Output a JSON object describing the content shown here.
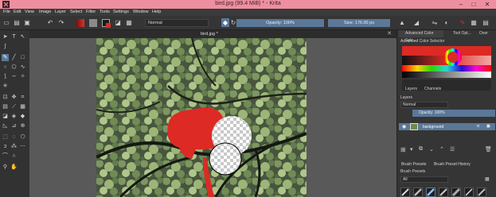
{
  "window": {
    "title": "bird.jpg (99.4 MiB) * - Krita",
    "minimize": "–",
    "maximize": "□",
    "close": "✕"
  },
  "menu": [
    "File",
    "Edit",
    "View",
    "Image",
    "Layer",
    "Select",
    "Filter",
    "Tools",
    "Settings",
    "Window",
    "Help"
  ],
  "toolbar": {
    "blend_mode": "Normal",
    "opacity_label": "Opacity: 100%",
    "size_label": "Size: 176.00 px"
  },
  "document": {
    "tab_name": "bird.jpg *",
    "close": "✕"
  },
  "dock": {
    "tabs": [
      "Advanced Color Sele...",
      "Tool Opt...",
      "Over"
    ],
    "color_selector_title": "Advanced Color Selector",
    "layer_tabs": [
      "Layers",
      "Channels"
    ],
    "layers_title": "Layers",
    "blend_mode": "Normal",
    "opacity_label": "Opacity: 100%",
    "layer_name": "background",
    "brush_tabs": [
      "Brush Presets",
      "Brush Preset History"
    ],
    "brush_presets_title": "Brush Presets",
    "brush_filter": "All"
  },
  "colors": {
    "title_bar": "#ee8fa0",
    "accent": "#5b7898",
    "paint_red": "#dd2a24"
  }
}
